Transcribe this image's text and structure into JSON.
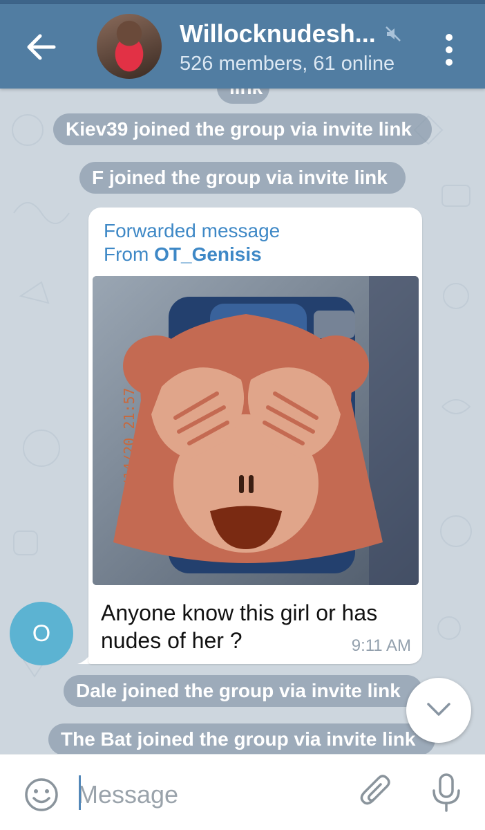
{
  "header": {
    "back_icon": "arrow-left-icon",
    "title": "Willocknudesh...",
    "muted_icon": "muted-speaker-icon",
    "subtitle": "526 members, 61 online",
    "menu_icon": "more-vertical-icon",
    "bar_color": "#517da2"
  },
  "chat": {
    "service_messages_top": [
      {
        "text": "link"
      },
      {
        "text": "Kiev39 joined the group via invite link"
      },
      {
        "text": "F joined the group via invite link"
      }
    ],
    "forwarded_message": {
      "label": "Forwarded message",
      "from_prefix": "From ",
      "from_name": "OT_Genisis",
      "photo_stamp": "03/14/20 21:57",
      "text": "Anyone know this girl or has nudes of her ?",
      "time": "9:11 AM",
      "sender_initial": "O"
    },
    "service_messages_bottom": [
      {
        "text": "Dale joined the group via invite link"
      },
      {
        "text": "The Bat joined the group via invite link"
      }
    ]
  },
  "composer": {
    "emoji_icon": "emoji-icon",
    "placeholder": "Message",
    "attach_icon": "paperclip-icon",
    "mic_icon": "microphone-icon"
  },
  "colors": {
    "chat_bg": "#cdd6de",
    "accent": "#3e88c6",
    "avatar_bg": "#5cb3d2"
  }
}
